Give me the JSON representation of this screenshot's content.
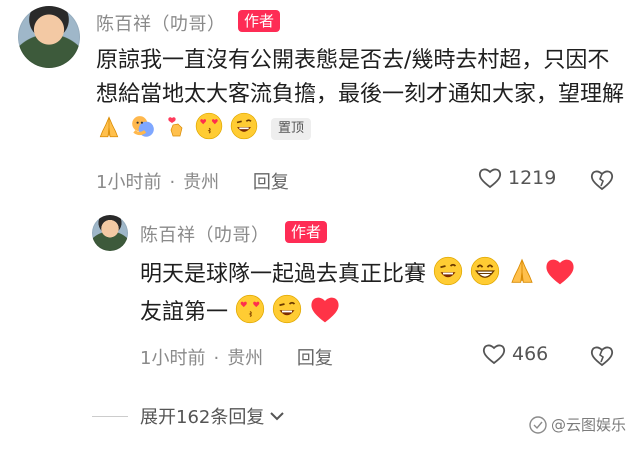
{
  "comment": {
    "author": "陈百祥（叻哥）",
    "author_badge": "作者",
    "text": "原諒我一直沒有公開表態是否去/幾時去村超，只因不想給當地太大客流負擔，最後一刻才通知大家，望理解",
    "emojis": [
      "pray-emoji",
      "hug-emoji",
      "finger-heart-emoji",
      "heart-eyes-emoji",
      "wink-emoji"
    ],
    "pinned_label": "置顶",
    "time": "1小时前",
    "location": "贵州",
    "reply_label": "回复",
    "likes": "1219"
  },
  "reply": {
    "author": "陈百祥（叻哥）",
    "author_badge": "作者",
    "text_line1": "明天是球隊一起過去真正比賽",
    "text_line2": "友誼第一",
    "emojis_line1": [
      "wink-emoji",
      "grin-emoji",
      "pray-emoji",
      "red-heart-emoji"
    ],
    "emojis_line2": [
      "heart-eyes-emoji",
      "wink-emoji",
      "red-heart-emoji"
    ],
    "time": "1小时前",
    "location": "贵州",
    "reply_label": "回复",
    "likes": "466"
  },
  "expand_label": "展开162条回复",
  "watermark": "@云图娱乐",
  "colors": {
    "badge": "#fe2c55",
    "meta": "#8a8a8a",
    "heart": "#ff3b3b"
  }
}
